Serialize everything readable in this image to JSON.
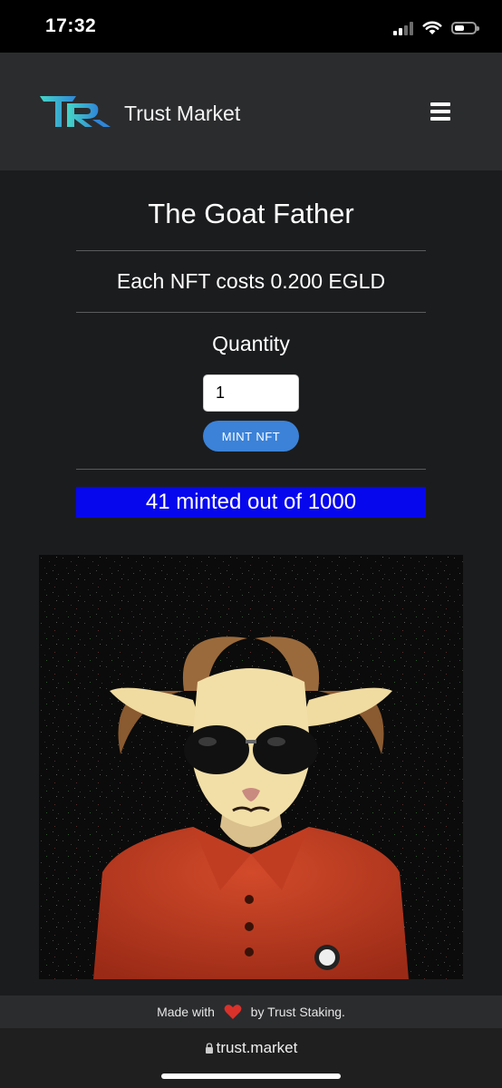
{
  "status_bar": {
    "time": "17:32"
  },
  "navbar": {
    "brand": "Trust Market",
    "menu_icon": "hamburger-menu-icon",
    "logo_icon": "tr-logo-icon"
  },
  "mint": {
    "title": "The Goat Father",
    "price_text": "Each NFT costs 0.200 EGLD",
    "quantity_label": "Quantity",
    "quantity_value": "1",
    "button_label": "MINT NFT",
    "minted_text": "41 minted out of 1000",
    "minted_count": 41,
    "supply": 1000
  },
  "nft_image": {
    "icon": "goat-in-sunglasses-artwork"
  },
  "footer": {
    "prefix": "Made with",
    "suffix": "by Trust Staking.",
    "heart_icon": "heart-icon"
  },
  "browser": {
    "url": "trust.market"
  },
  "colors": {
    "accent": "#3b82d8",
    "banner": "#0707ee",
    "background": "#1b1c1e",
    "navbar": "#2b2c2e",
    "heart": "#d9322b"
  }
}
